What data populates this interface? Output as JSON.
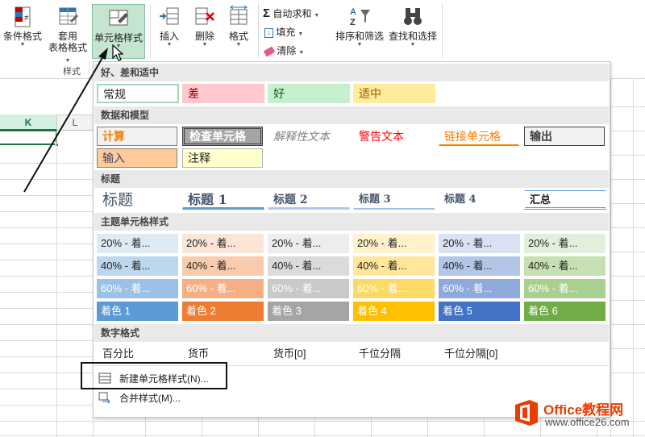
{
  "ribbon": {
    "cond_format": "条件格式",
    "table_format_line1": "套用",
    "table_format_line2": "表格格式",
    "cell_styles": "单元格样式",
    "insert": "插入",
    "delete": "删除",
    "format": "格式",
    "autosum": "自动求和",
    "fill": "填充",
    "clear": "清除",
    "sort_filter": "排序和筛选",
    "find_select": "查找和选择",
    "group_styles": "样式"
  },
  "sheet": {
    "col_k": "K",
    "col_l": "L"
  },
  "gallery": {
    "sections": {
      "good_bad": "好、差和适中",
      "data_model": "数据和模型",
      "titles": "标题",
      "theme": "主题单元格样式",
      "number": "数字格式"
    },
    "good_bad": [
      "常规",
      "差",
      "好",
      "适中"
    ],
    "data_model_row1": [
      "计算",
      "检查单元格",
      "解释性文本",
      "警告文本",
      "链接单元格",
      "输出"
    ],
    "data_model_row2": [
      "输入",
      "注释"
    ],
    "titles": [
      "标题",
      "标题 1",
      "标题 2",
      "标题 3",
      "标题 4",
      "汇总"
    ],
    "theme_row20": [
      "20% - 着...",
      "20% - 着...",
      "20% - 着...",
      "20% - 着...",
      "20% - 着...",
      "20% - 着..."
    ],
    "theme_row40": [
      "40% - 着...",
      "40% - 着...",
      "40% - 着...",
      "40% - 着...",
      "40% - 着...",
      "40% - 着..."
    ],
    "theme_row60": [
      "60% - 着...",
      "60% - 着...",
      "60% - 着...",
      "60% - 着...",
      "60% - 着...",
      "60% - 着..."
    ],
    "theme_accent": [
      "着色 1",
      "着色 2",
      "着色 3",
      "着色 4",
      "着色 5",
      "着色 6"
    ],
    "number": [
      "百分比",
      "货币",
      "货币[0]",
      "千位分隔",
      "千位分隔[0]"
    ],
    "menu_new": "新建单元格样式(N)...",
    "menu_merge": "合并样式(M)..."
  },
  "watermark": {
    "brand": "Office教程网",
    "url": "www.office26.com"
  },
  "colors": {
    "accent_green": "#217346",
    "ribbon_selected": "#c6e5d1"
  }
}
